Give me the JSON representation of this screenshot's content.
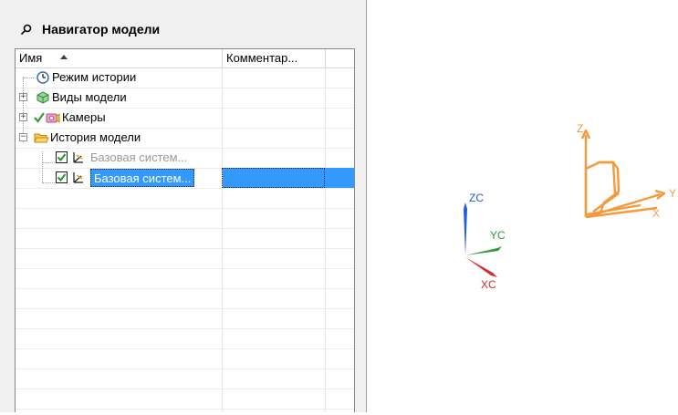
{
  "navigator": {
    "title": "Навигатор модели",
    "columns": {
      "name": "Имя",
      "comment": "Комментар..."
    },
    "rows": [
      {
        "label": "Режим истории"
      },
      {
        "label": "Виды модели"
      },
      {
        "label": "Камеры"
      },
      {
        "label": "История модели"
      },
      {
        "label": "Базовая систем..."
      },
      {
        "label": "Базовая систем..."
      }
    ]
  },
  "viewport": {
    "wcs": {
      "z": "ZC",
      "y": "YC",
      "x": "XC"
    },
    "datum": {
      "z": "Z",
      "y": "Y",
      "x": "X"
    }
  },
  "colors": {
    "selection": "#3399ff",
    "datum": "#f59a3c",
    "zc": "#1f5fd9",
    "yc": "#2e9a3a",
    "xc": "#d42a2a"
  }
}
